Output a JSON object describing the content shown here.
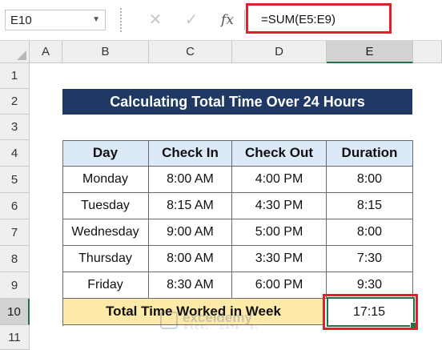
{
  "formula_bar": {
    "namebox": "E10",
    "cancel_icon": "✕",
    "enter_icon": "✓",
    "fx_icon": "fx",
    "formula": "=SUM(E5:E9)"
  },
  "columns": [
    "A",
    "B",
    "C",
    "D",
    "E"
  ],
  "rows": [
    "1",
    "2",
    "3",
    "4",
    "5",
    "6",
    "7",
    "8",
    "9",
    "10",
    "11"
  ],
  "banner": "Calculating Total Time Over 24 Hours",
  "table": {
    "headers": [
      "Day",
      "Check In",
      "Check Out",
      "Duration"
    ],
    "rows": [
      [
        "Monday",
        "8:00 AM",
        "4:00 PM",
        "8:00"
      ],
      [
        "Tuesday",
        "8:15 AM",
        "4:30 PM",
        "8:15"
      ],
      [
        "Wednesday",
        "9:00 AM",
        "5:00 PM",
        "8:00"
      ],
      [
        "Thursday",
        "8:00 AM",
        "3:30 PM",
        "7:30"
      ],
      [
        "Friday",
        "8:30 AM",
        "6:00 PM",
        "9:30"
      ]
    ]
  },
  "total": {
    "label": "Total Time Worked in Week",
    "value": "17:15"
  },
  "watermark": {
    "name": "exceldemy",
    "tagline": "EXCEL · DATA · BI"
  },
  "colors": {
    "banner": "#1f3864",
    "header_fill": "#dbe9f8",
    "total_fill": "#fde9a8",
    "highlight": "#e0212b",
    "selection": "#217346"
  }
}
